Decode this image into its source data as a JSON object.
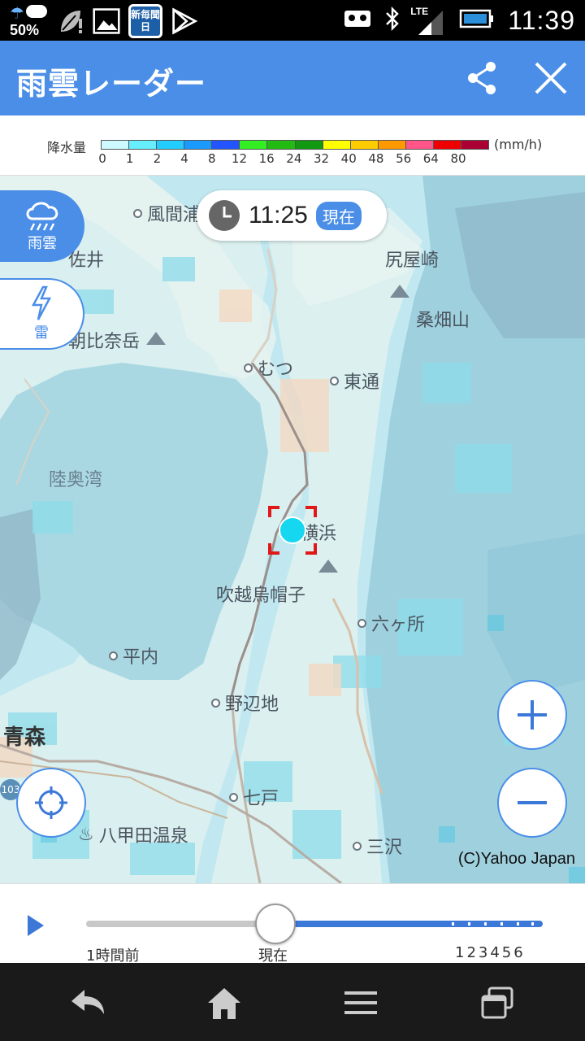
{
  "status_bar": {
    "battery_percent_text": "50%",
    "network": "LTE",
    "time": "11:39",
    "news_icon_text": "新毎聞日"
  },
  "app_bar": {
    "title": "雨雲レーダー",
    "share_icon": "share-icon",
    "close_icon": "close-icon"
  },
  "legend": {
    "label": "降水量",
    "unit": "(mm/h)",
    "ticks": [
      "0",
      "1",
      "2",
      "4",
      "8",
      "12",
      "16",
      "24",
      "32",
      "40",
      "48",
      "56",
      "64",
      "80"
    ],
    "colors": [
      "#ccfaff",
      "#66eeff",
      "#22ccff",
      "#1a99ff",
      "#2255ff",
      "#33ee22",
      "#22bb11",
      "#119911",
      "#ffff00",
      "#ffcc00",
      "#ff9900",
      "#ff5588",
      "#ee0000",
      "#aa0033"
    ]
  },
  "map": {
    "time_pill": {
      "time": "11:25",
      "badge": "現在"
    },
    "tabs": {
      "rain": "雨雲",
      "thunder": "雷"
    },
    "places": {
      "kazamaura": "風間浦",
      "sai": "佐井",
      "shiriyazaki": "尻屋崎",
      "kuwahatayama": "桑畑山",
      "asahinadake": "朝比奈岳",
      "mutsu": "むつ",
      "higashidori": "東通",
      "mutsuwan": "陸奥湾",
      "yokohama": "横浜",
      "fukkoshi": "吹越烏帽子",
      "rokkasho": "六ヶ所",
      "hiranai": "平内",
      "noheji": "野辺地",
      "aomori": "青森",
      "shichinohe": "七戸",
      "hakkoda": "八甲田温泉",
      "misawa": "三沢",
      "route": "103"
    },
    "copyright": "(C)Yahoo Japan"
  },
  "timeline": {
    "start_label": "1時間前",
    "now_label": "現在",
    "hour_labels": "123456",
    "position_fraction": 0.41
  }
}
